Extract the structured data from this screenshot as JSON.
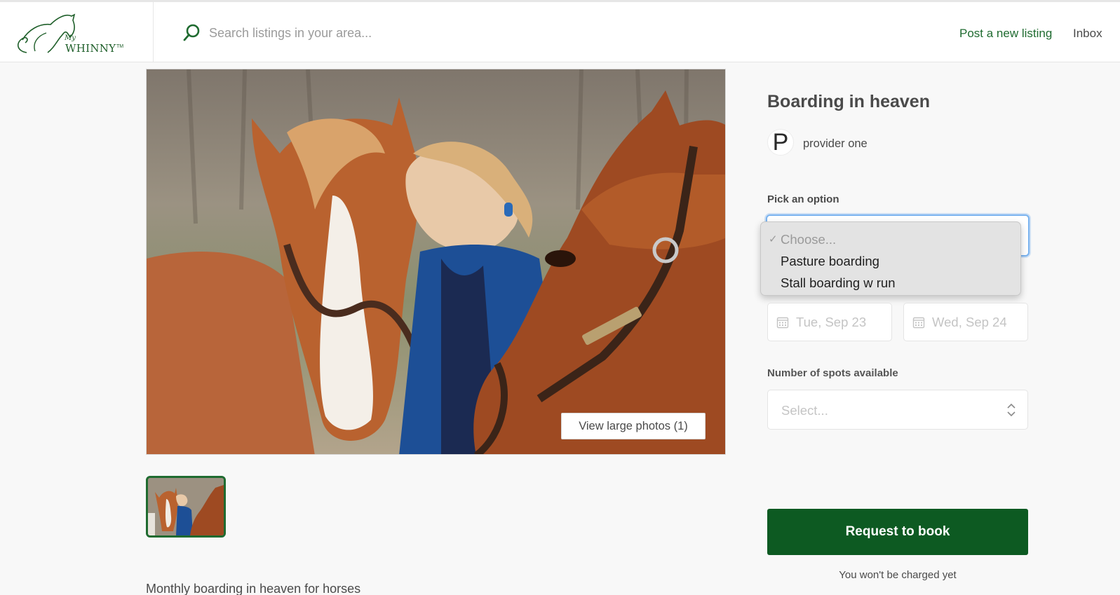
{
  "header": {
    "logo": {
      "script_text": "My",
      "brand_text": "WHINNY",
      "tm": "TM"
    },
    "search": {
      "placeholder": "Search listings in your area..."
    },
    "nav": {
      "post_listing": "Post a new listing",
      "inbox": "Inbox"
    }
  },
  "gallery": {
    "view_large_label": "View large photos (1)"
  },
  "listing": {
    "title": "Boarding in heaven",
    "provider": {
      "avatar_initial": "P",
      "name": "provider one"
    },
    "description": "Monthly boarding in heaven for horses"
  },
  "booking": {
    "option_label": "Pick an option",
    "options": [
      {
        "label": "Choose...",
        "selected": true
      },
      {
        "label": "Pasture boarding",
        "selected": false
      },
      {
        "label": "Stall boarding w run",
        "selected": false
      }
    ],
    "start_date_placeholder": "Tue, Sep 23",
    "end_date_placeholder": "Wed, Sep 24",
    "spots_label": "Number of spots available",
    "spots_placeholder": "Select...",
    "request_button": "Request to book",
    "no_charge_note": "You won't be charged yet"
  },
  "colors": {
    "brand_green": "#0d5a22",
    "link_green": "#1f6b30",
    "focus_blue": "#7ab3ef"
  }
}
